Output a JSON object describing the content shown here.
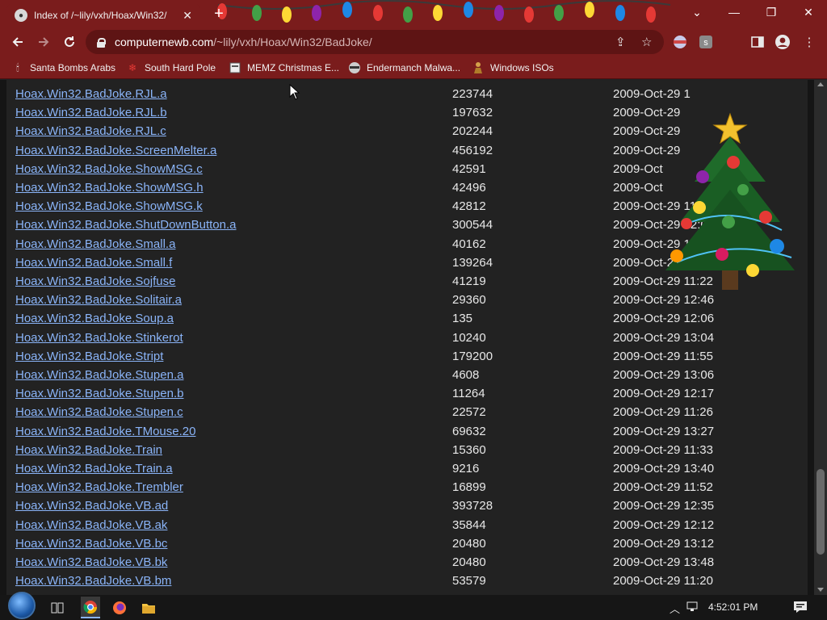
{
  "window": {
    "tab_title": "Index of /~lily/vxh/Hoax/Win32/",
    "tab_close": "✕",
    "new_tab": "+",
    "minimize": "—",
    "restore": "❐",
    "close": "✕",
    "theme_bg": "#7a1c1c"
  },
  "toolbar": {
    "url_host": "computernewb.com",
    "url_path": "/~lily/vxh/Hoax/Win32/BadJoke/"
  },
  "bookmarks": [
    {
      "label": "Santa Bombs Arabs",
      "icon": "candle-icon"
    },
    {
      "label": "South Hard Pole",
      "icon": "snowflake-icon"
    },
    {
      "label": "MEMZ Christmas E...",
      "icon": "page-icon"
    },
    {
      "label": "Endermanch Malwa...",
      "icon": "raccoon-icon"
    },
    {
      "label": "Windows ISOs",
      "icon": "figure-icon"
    }
  ],
  "listing": {
    "rows": [
      {
        "name": "Hoax.Win32.BadJoke.RJL.a",
        "size": "223744",
        "date": "2009-Oct-29 1"
      },
      {
        "name": "Hoax.Win32.BadJoke.RJL.b",
        "size": "197632",
        "date": "2009-Oct-29"
      },
      {
        "name": "Hoax.Win32.BadJoke.RJL.c",
        "size": "202244",
        "date": "2009-Oct-29"
      },
      {
        "name": "Hoax.Win32.BadJoke.ScreenMelter.a",
        "size": "456192",
        "date": "2009-Oct-29"
      },
      {
        "name": "Hoax.Win32.BadJoke.ShowMSG.c",
        "size": "42591",
        "date": "2009-Oct"
      },
      {
        "name": "Hoax.Win32.BadJoke.ShowMSG.h",
        "size": "42496",
        "date": "2009-Oct"
      },
      {
        "name": "Hoax.Win32.BadJoke.ShowMSG.k",
        "size": "42812",
        "date": "2009-Oct-29 11:28"
      },
      {
        "name": "Hoax.Win32.BadJoke.ShutDownButton.a",
        "size": "300544",
        "date": "2009-Oct-29 12:01"
      },
      {
        "name": "Hoax.Win32.BadJoke.Small.a",
        "size": "40162",
        "date": "2009-Oct-29 12:38"
      },
      {
        "name": "Hoax.Win32.BadJoke.Small.f",
        "size": "139264",
        "date": "2009-Oct-29 13:00"
      },
      {
        "name": "Hoax.Win32.BadJoke.Sojfuse",
        "size": "41219",
        "date": "2009-Oct-29 11:22"
      },
      {
        "name": "Hoax.Win32.BadJoke.Solitair.a",
        "size": "29360",
        "date": "2009-Oct-29 12:46"
      },
      {
        "name": "Hoax.Win32.BadJoke.Soup.a",
        "size": "135",
        "date": "2009-Oct-29 12:06"
      },
      {
        "name": "Hoax.Win32.BadJoke.Stinkerot",
        "size": "10240",
        "date": "2009-Oct-29 13:04"
      },
      {
        "name": "Hoax.Win32.BadJoke.Stript",
        "size": "179200",
        "date": "2009-Oct-29 11:55"
      },
      {
        "name": "Hoax.Win32.BadJoke.Stupen.a",
        "size": "4608",
        "date": "2009-Oct-29 13:06"
      },
      {
        "name": "Hoax.Win32.BadJoke.Stupen.b",
        "size": "11264",
        "date": "2009-Oct-29 12:17"
      },
      {
        "name": "Hoax.Win32.BadJoke.Stupen.c",
        "size": "22572",
        "date": "2009-Oct-29 11:26"
      },
      {
        "name": "Hoax.Win32.BadJoke.TMouse.20",
        "size": "69632",
        "date": "2009-Oct-29 13:27"
      },
      {
        "name": "Hoax.Win32.BadJoke.Train",
        "size": "15360",
        "date": "2009-Oct-29 11:33"
      },
      {
        "name": "Hoax.Win32.BadJoke.Train.a",
        "size": "9216",
        "date": "2009-Oct-29 13:40"
      },
      {
        "name": "Hoax.Win32.BadJoke.Trembler",
        "size": "16899",
        "date": "2009-Oct-29 11:52"
      },
      {
        "name": "Hoax.Win32.BadJoke.VB.ad",
        "size": "393728",
        "date": "2009-Oct-29 12:35"
      },
      {
        "name": "Hoax.Win32.BadJoke.VB.ak",
        "size": "35844",
        "date": "2009-Oct-29 12:12"
      },
      {
        "name": "Hoax.Win32.BadJoke.VB.bc",
        "size": "20480",
        "date": "2009-Oct-29 13:12"
      },
      {
        "name": "Hoax.Win32.BadJoke.VB.bk",
        "size": "20480",
        "date": "2009-Oct-29 13:48"
      },
      {
        "name": "Hoax.Win32.BadJoke.VB.bm",
        "size": "53579",
        "date": "2009-Oct-29 11:20"
      }
    ],
    "link_color": "#8ab4f8",
    "text_color": "#e8e8e8"
  },
  "taskbar": {
    "clock": "4:52:01 PM"
  }
}
